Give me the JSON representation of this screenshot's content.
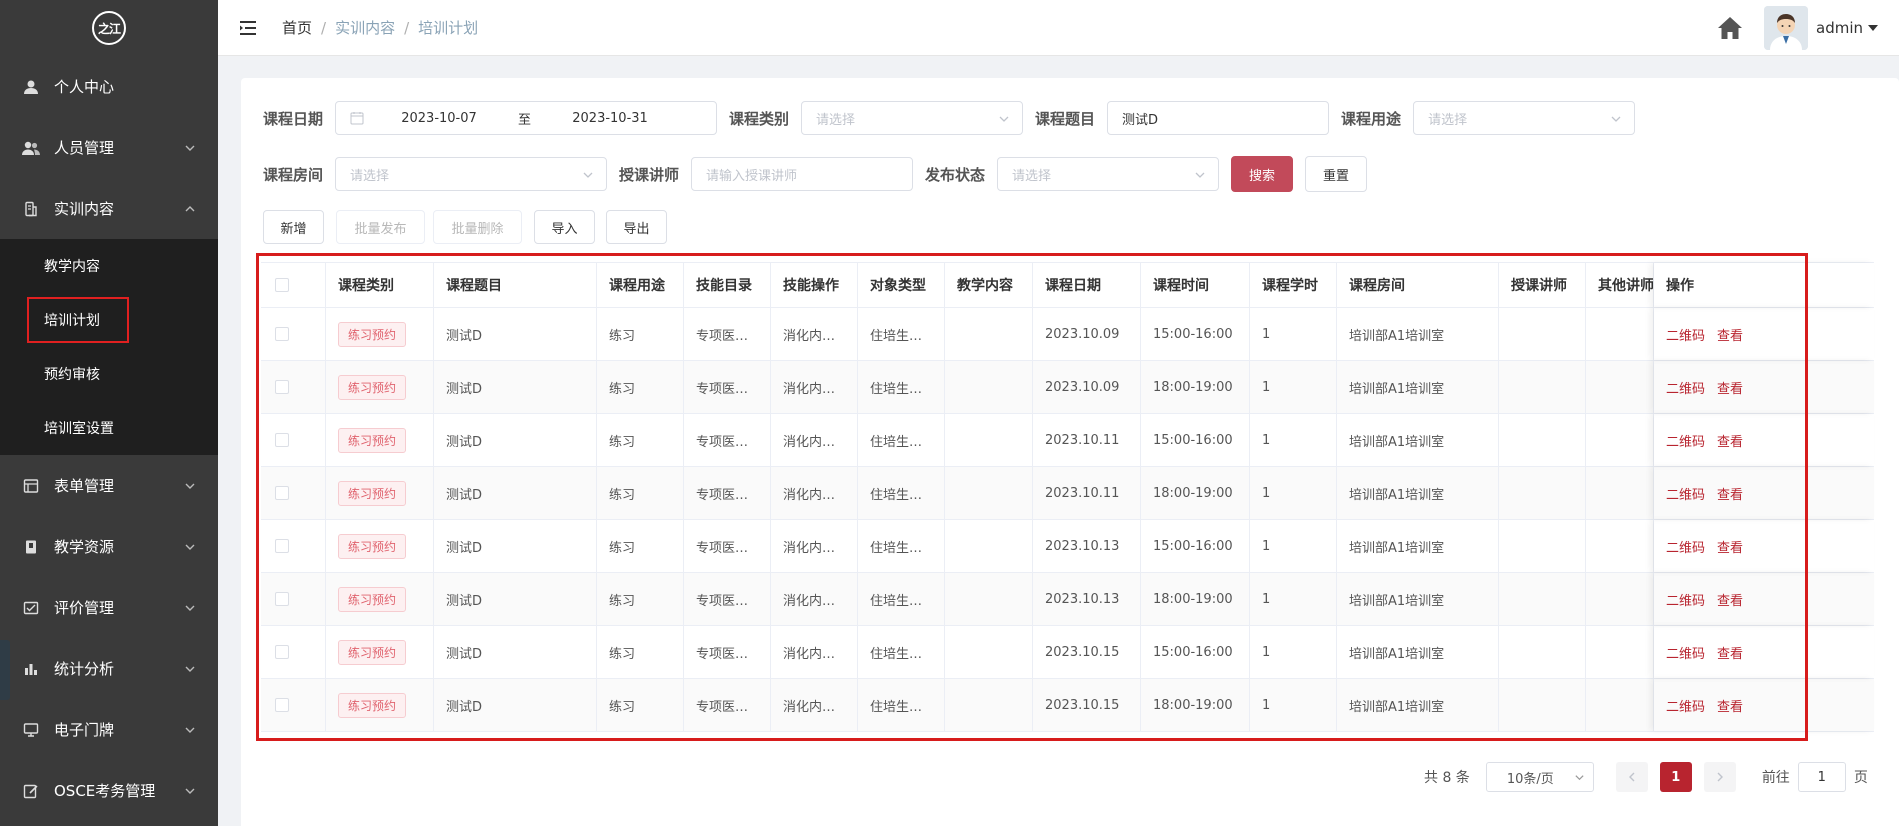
{
  "sidebar": {
    "logo_text": "之江",
    "items": [
      {
        "label": "个人中心",
        "icon": "user-icon",
        "expandable": false
      },
      {
        "label": "人员管理",
        "icon": "users-icon",
        "expandable": true
      },
      {
        "label": "实训内容",
        "icon": "content-icon",
        "expandable": true,
        "expanded": true
      },
      {
        "label": "表单管理",
        "icon": "form-icon",
        "expandable": true
      },
      {
        "label": "教学资源",
        "icon": "book-icon",
        "expandable": true
      },
      {
        "label": "评价管理",
        "icon": "evaluation-icon",
        "expandable": true
      },
      {
        "label": "统计分析",
        "icon": "chart-icon",
        "expandable": true
      },
      {
        "label": "电子门牌",
        "icon": "monitor-icon",
        "expandable": true
      },
      {
        "label": "OSCE考务管理",
        "icon": "edit-icon",
        "expandable": true
      }
    ],
    "submenu": [
      {
        "label": "教学内容"
      },
      {
        "label": "培训计划",
        "active": true
      },
      {
        "label": "预约审核"
      },
      {
        "label": "培训室设置"
      }
    ]
  },
  "header": {
    "breadcrumb": [
      "首页",
      "实训内容",
      "培训计划"
    ],
    "username": "admin"
  },
  "filters": {
    "date_label": "课程日期",
    "date_start": "2023-10-07",
    "date_to": "至",
    "date_end": "2023-10-31",
    "category_label": "课程类别",
    "category_placeholder": "请选择",
    "topic_label": "课程题目",
    "topic_value": "测试D",
    "purpose_label": "课程用途",
    "purpose_placeholder": "请选择",
    "room_label": "课程房间",
    "room_placeholder": "请选择",
    "teacher_label": "授课讲师",
    "teacher_placeholder": "请输入授课讲师",
    "status_label": "发布状态",
    "status_placeholder": "请选择",
    "search_btn": "搜索",
    "reset_btn": "重置"
  },
  "toolbar": {
    "add": "新增",
    "batch_publish": "批量发布",
    "batch_delete": "批量删除",
    "import": "导入",
    "export": "导出"
  },
  "table": {
    "columns": [
      "课程类别",
      "课程题目",
      "课程用途",
      "技能目录",
      "技能操作",
      "对象类型",
      "教学内容",
      "课程日期",
      "课程时间",
      "课程学时",
      "课程房间",
      "授课讲师",
      "其他讲师",
      "操作"
    ],
    "rows": [
      {
        "category": "练习预约",
        "topic": "测试D",
        "purpose": "练习",
        "skill_dir": "专项医…",
        "skill_op": "消化内…",
        "target": "住培生…",
        "content": "",
        "date": "2023.10.09",
        "time": "15:00-16:00",
        "hours": "1",
        "room": "培训部A1培训室",
        "teacher": "",
        "other": ""
      },
      {
        "category": "练习预约",
        "topic": "测试D",
        "purpose": "练习",
        "skill_dir": "专项医…",
        "skill_op": "消化内…",
        "target": "住培生…",
        "content": "",
        "date": "2023.10.09",
        "time": "18:00-19:00",
        "hours": "1",
        "room": "培训部A1培训室",
        "teacher": "",
        "other": ""
      },
      {
        "category": "练习预约",
        "topic": "测试D",
        "purpose": "练习",
        "skill_dir": "专项医…",
        "skill_op": "消化内…",
        "target": "住培生…",
        "content": "",
        "date": "2023.10.11",
        "time": "15:00-16:00",
        "hours": "1",
        "room": "培训部A1培训室",
        "teacher": "",
        "other": ""
      },
      {
        "category": "练习预约",
        "topic": "测试D",
        "purpose": "练习",
        "skill_dir": "专项医…",
        "skill_op": "消化内…",
        "target": "住培生…",
        "content": "",
        "date": "2023.10.11",
        "time": "18:00-19:00",
        "hours": "1",
        "room": "培训部A1培训室",
        "teacher": "",
        "other": ""
      },
      {
        "category": "练习预约",
        "topic": "测试D",
        "purpose": "练习",
        "skill_dir": "专项医…",
        "skill_op": "消化内…",
        "target": "住培生…",
        "content": "",
        "date": "2023.10.13",
        "time": "15:00-16:00",
        "hours": "1",
        "room": "培训部A1培训室",
        "teacher": "",
        "other": ""
      },
      {
        "category": "练习预约",
        "topic": "测试D",
        "purpose": "练习",
        "skill_dir": "专项医…",
        "skill_op": "消化内…",
        "target": "住培生…",
        "content": "",
        "date": "2023.10.13",
        "time": "18:00-19:00",
        "hours": "1",
        "room": "培训部A1培训室",
        "teacher": "",
        "other": ""
      },
      {
        "category": "练习预约",
        "topic": "测试D",
        "purpose": "练习",
        "skill_dir": "专项医…",
        "skill_op": "消化内…",
        "target": "住培生…",
        "content": "",
        "date": "2023.10.15",
        "time": "15:00-16:00",
        "hours": "1",
        "room": "培训部A1培训室",
        "teacher": "",
        "other": ""
      },
      {
        "category": "练习预约",
        "topic": "测试D",
        "purpose": "练习",
        "skill_dir": "专项医…",
        "skill_op": "消化内…",
        "target": "住培生…",
        "content": "",
        "date": "2023.10.15",
        "time": "18:00-19:00",
        "hours": "1",
        "room": "培训部A1培训室",
        "teacher": "",
        "other": ""
      }
    ],
    "actions": {
      "qrcode": "二维码",
      "view": "查看"
    }
  },
  "pagination": {
    "total": "共 8 条",
    "page_size": "10条/页",
    "current_page": "1",
    "goto_label": "前往",
    "goto_value": "1",
    "page_suffix": "页"
  },
  "colors": {
    "sidebar_bg": "#3a3a3a",
    "submenu_bg": "#1f1f1f",
    "accent": "#b8242f",
    "search_button": "#c24a5a",
    "tag_text": "#e0636e",
    "highlight_outline": "#d71c1c"
  }
}
